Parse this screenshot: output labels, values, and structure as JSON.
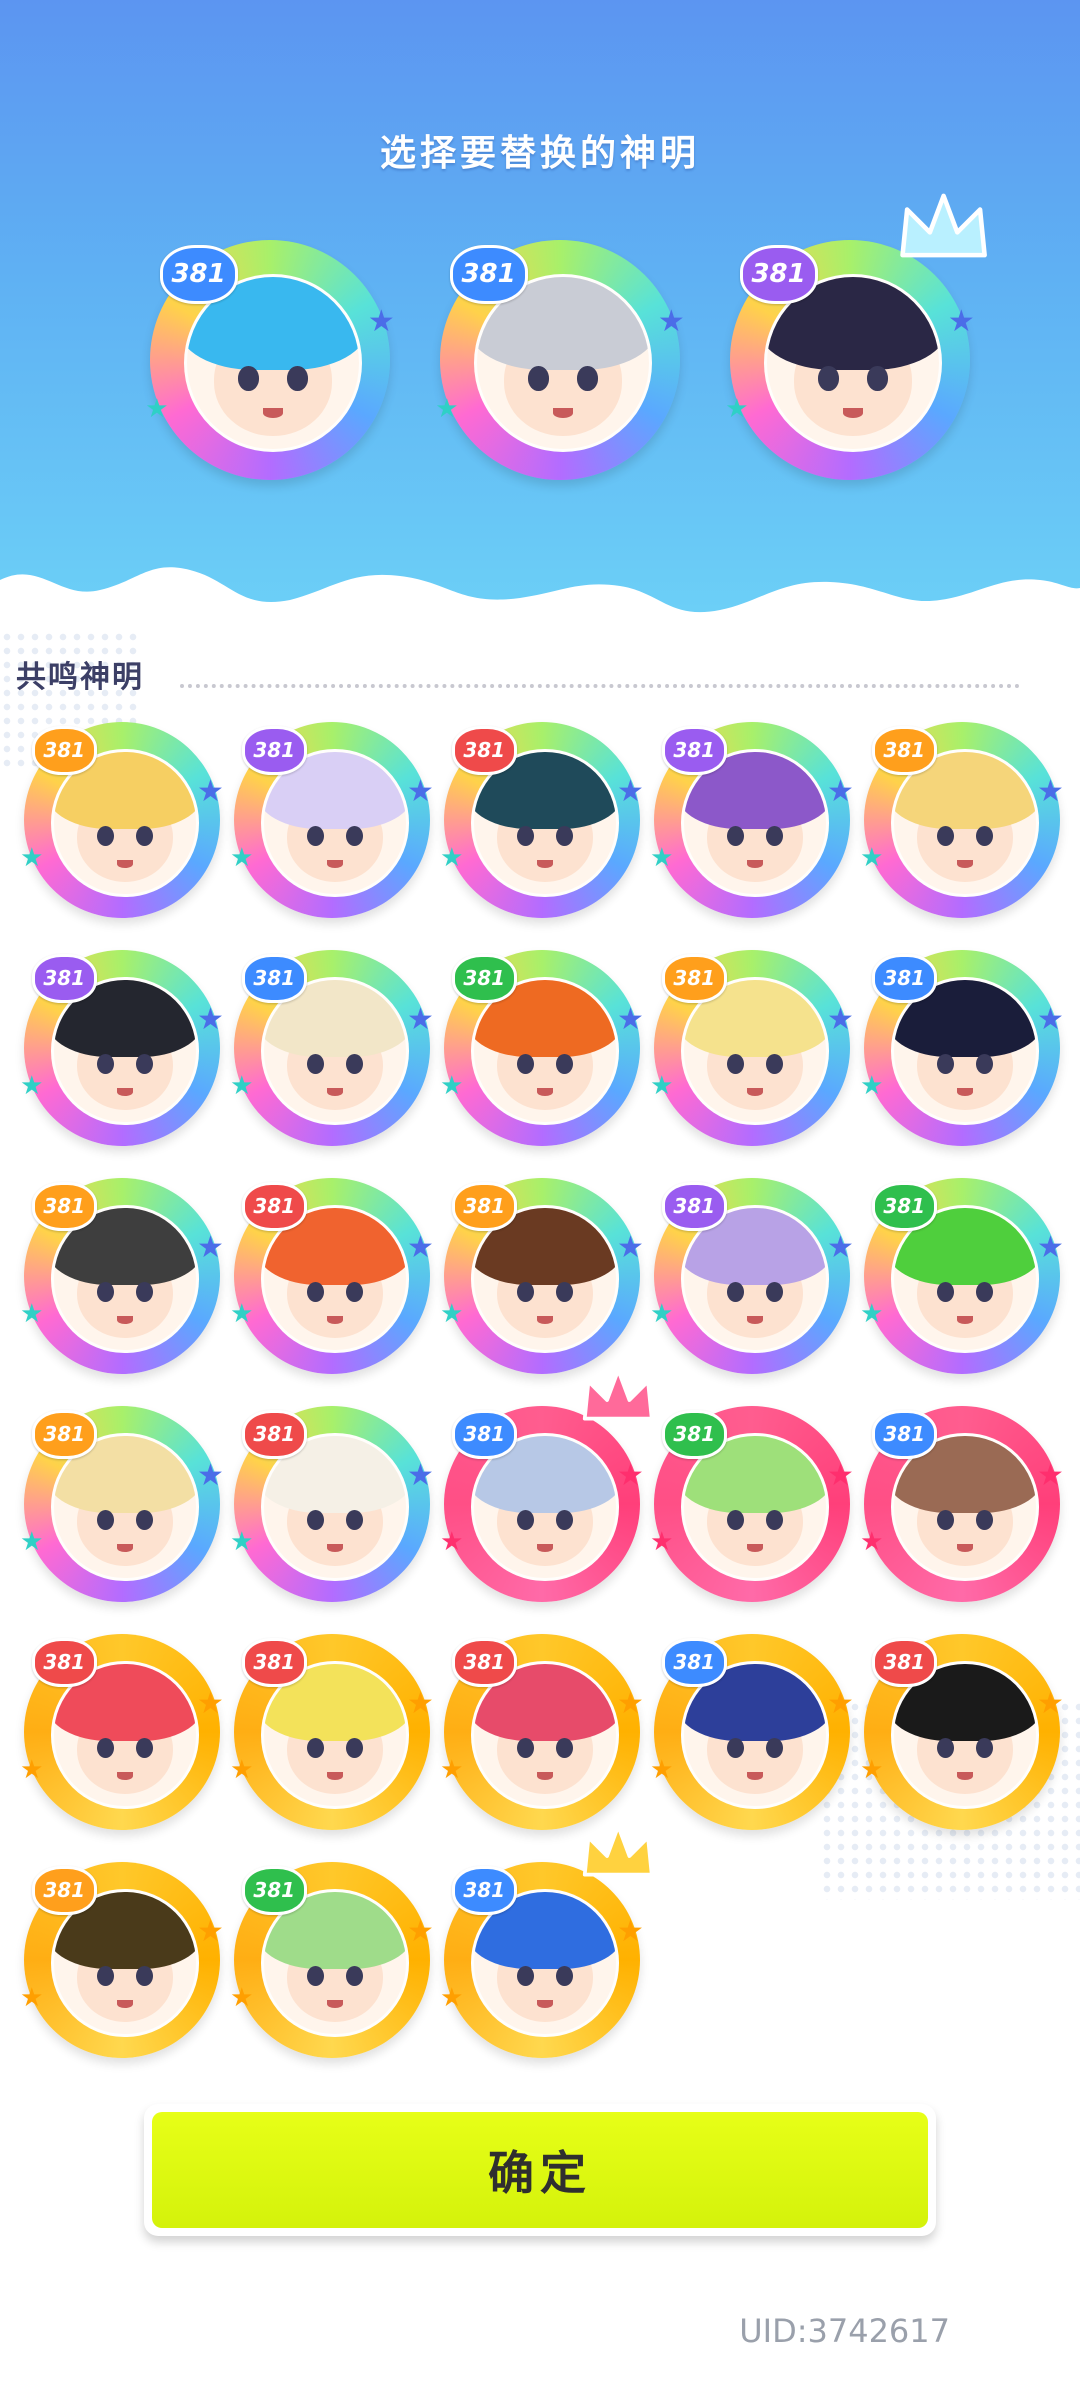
{
  "header": {
    "title": "选择要替换的神明",
    "selected": [
      {
        "level": "381",
        "ring": "rainbow",
        "level_color": "blue",
        "hair": "#39b8ef",
        "crown": false
      },
      {
        "level": "381",
        "ring": "rainbow",
        "level_color": "blue",
        "hair": "#c9ccd5",
        "crown": false
      },
      {
        "level": "381",
        "ring": "rainbow",
        "level_color": "purple",
        "hair": "#2a2745",
        "crown": true,
        "crown_color": "#b9f0ff"
      }
    ]
  },
  "section": {
    "title": "共鸣神明"
  },
  "gods": [
    {
      "level": "381",
      "ring": "rainbow",
      "level_color": "orange",
      "hair": "#f6cf62"
    },
    {
      "level": "381",
      "ring": "rainbow",
      "level_color": "purple",
      "hair": "#d9cff5"
    },
    {
      "level": "381",
      "ring": "rainbow",
      "level_color": "red",
      "hair": "#1f4a5a"
    },
    {
      "level": "381",
      "ring": "rainbow",
      "level_color": "purple",
      "hair": "#8c58c9"
    },
    {
      "level": "381",
      "ring": "rainbow",
      "level_color": "orange",
      "hair": "#f5d57a"
    },
    {
      "level": "381",
      "ring": "rainbow",
      "level_color": "purple",
      "hair": "#24262f"
    },
    {
      "level": "381",
      "ring": "rainbow",
      "level_color": "blue",
      "hair": "#f2e6c8"
    },
    {
      "level": "381",
      "ring": "rainbow",
      "level_color": "green",
      "hair": "#ee6a22"
    },
    {
      "level": "381",
      "ring": "rainbow",
      "level_color": "orange",
      "hair": "#f5e28d"
    },
    {
      "level": "381",
      "ring": "rainbow",
      "level_color": "blue",
      "hair": "#1a1d3a"
    },
    {
      "level": "381",
      "ring": "rainbow",
      "level_color": "orange",
      "hair": "#3e3e3e"
    },
    {
      "level": "381",
      "ring": "rainbow",
      "level_color": "red",
      "hair": "#f0632f"
    },
    {
      "level": "381",
      "ring": "rainbow",
      "level_color": "orange",
      "hair": "#6a3a22"
    },
    {
      "level": "381",
      "ring": "rainbow",
      "level_color": "purple",
      "hair": "#b8a2e6"
    },
    {
      "level": "381",
      "ring": "rainbow",
      "level_color": "green",
      "hair": "#4fcf3d"
    },
    {
      "level": "381",
      "ring": "rainbow",
      "level_color": "orange",
      "hair": "#f3dfa4"
    },
    {
      "level": "381",
      "ring": "rainbow",
      "level_color": "red",
      "hair": "#f5f0e6"
    },
    {
      "level": "381",
      "ring": "pink",
      "level_color": "blue",
      "hair": "#b7c8e6",
      "crown": true,
      "crown_color": "#ff6a9a"
    },
    {
      "level": "381",
      "ring": "pink",
      "level_color": "green",
      "hair": "#9ee07a"
    },
    {
      "level": "381",
      "ring": "pink",
      "level_color": "blue",
      "hair": "#9a6a54"
    },
    {
      "level": "381",
      "ring": "gold",
      "level_color": "red",
      "hair": "#ef4b5a"
    },
    {
      "level": "381",
      "ring": "gold",
      "level_color": "red",
      "hair": "#f3e25a"
    },
    {
      "level": "381",
      "ring": "gold",
      "level_color": "red",
      "hair": "#e74b6a"
    },
    {
      "level": "381",
      "ring": "gold",
      "level_color": "blue",
      "hair": "#2d3f9a"
    },
    {
      "level": "381",
      "ring": "gold",
      "level_color": "red",
      "hair": "#1a1a1a"
    },
    {
      "level": "381",
      "ring": "gold",
      "level_color": "orange",
      "hair": "#4a3a1a"
    },
    {
      "level": "381",
      "ring": "gold",
      "level_color": "green",
      "hair": "#9fdc8a"
    },
    {
      "level": "381",
      "ring": "gold",
      "level_color": "blue",
      "hair": "#2f6de0",
      "crown": true,
      "crown_color": "#ffd23f"
    }
  ],
  "confirm_button": {
    "label": "确定"
  },
  "footer": {
    "uid": "UID:3742617"
  },
  "colors": {
    "accent": "#dff716",
    "banner_top": "#5c95f1",
    "banner_bottom": "#6cd0f7"
  }
}
